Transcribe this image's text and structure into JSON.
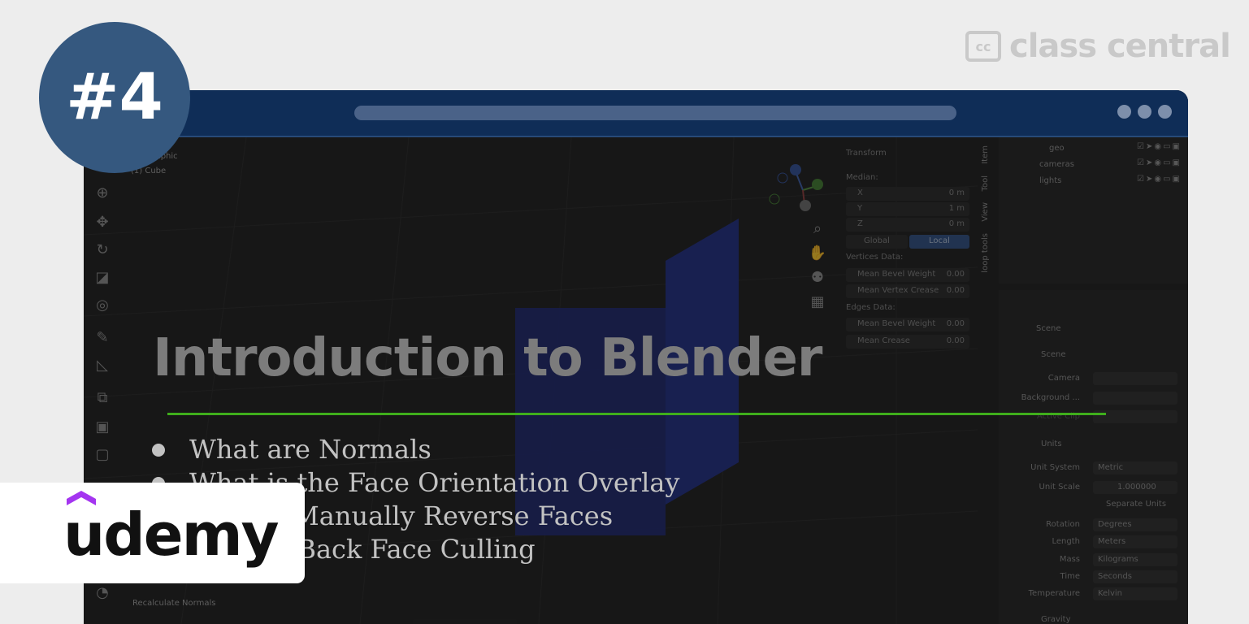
{
  "badge": {
    "number": "#4"
  },
  "brand": {
    "cc_icon": "cc",
    "name": "class central"
  },
  "window": {
    "dots": [
      "dot-1",
      "dot-2",
      "dot-3"
    ]
  },
  "viewport": {
    "view_label": "ographic",
    "object_label": "(1) Cube"
  },
  "npanel": {
    "header": "Transform",
    "median": "Median:",
    "x_label": "X",
    "x_val": "0 m",
    "y_label": "Y",
    "y_val": "1 m",
    "z_label": "Z",
    "z_val": "0 m",
    "global": "Global",
    "local": "Local",
    "vertices": "Vertices Data:",
    "mean_bevel_weight": "Mean Bevel Weight",
    "mbw_val": "0.00",
    "mean_vertex_crease": "Mean Vertex Crease",
    "mvc_val": "0.00",
    "edges": "Edges Data:",
    "edge_bevel_weight": "Mean Bevel Weight",
    "ebw_val": "0.00",
    "mean_crease": "Mean Crease",
    "mc_val": "0.00",
    "tabs": [
      "Item",
      "Tool",
      "View",
      "loop tools"
    ]
  },
  "outliner": {
    "items": [
      "geo",
      "cameras",
      "lights"
    ]
  },
  "props": {
    "scene_header": "Scene",
    "scene_section": "Scene",
    "camera": "Camera",
    "background": "Background ...",
    "active_clip": "Active Clip",
    "units_section": "Units",
    "unit_system": "Unit System",
    "unit_system_val": "Metric",
    "unit_scale": "Unit Scale",
    "unit_scale_val": "1.000000",
    "separate_units": "Separate Units",
    "rotation": "Rotation",
    "rotation_val": "Degrees",
    "length": "Length",
    "length_val": "Meters",
    "mass": "Mass",
    "mass_val": "Kilograms",
    "time": "Time",
    "time_val": "Seconds",
    "temperature": "Temperature",
    "temperature_val": "Kelvin",
    "gravity": "Gravity"
  },
  "recalc": "Recalculate Normals",
  "slide": {
    "title": "Introduction to Blender",
    "bullets": [
      "What are Normals",
      "What is the Face Orientation Overlay",
      "How to Manually Reverse Faces",
      "What is Back Face Culling"
    ]
  },
  "udemy": {
    "name": "udemy",
    "accent": "#a435f0"
  },
  "colors": {
    "badge": "#35587f",
    "titlebar": "#0f2d57",
    "green_line": "#3fae1c"
  }
}
